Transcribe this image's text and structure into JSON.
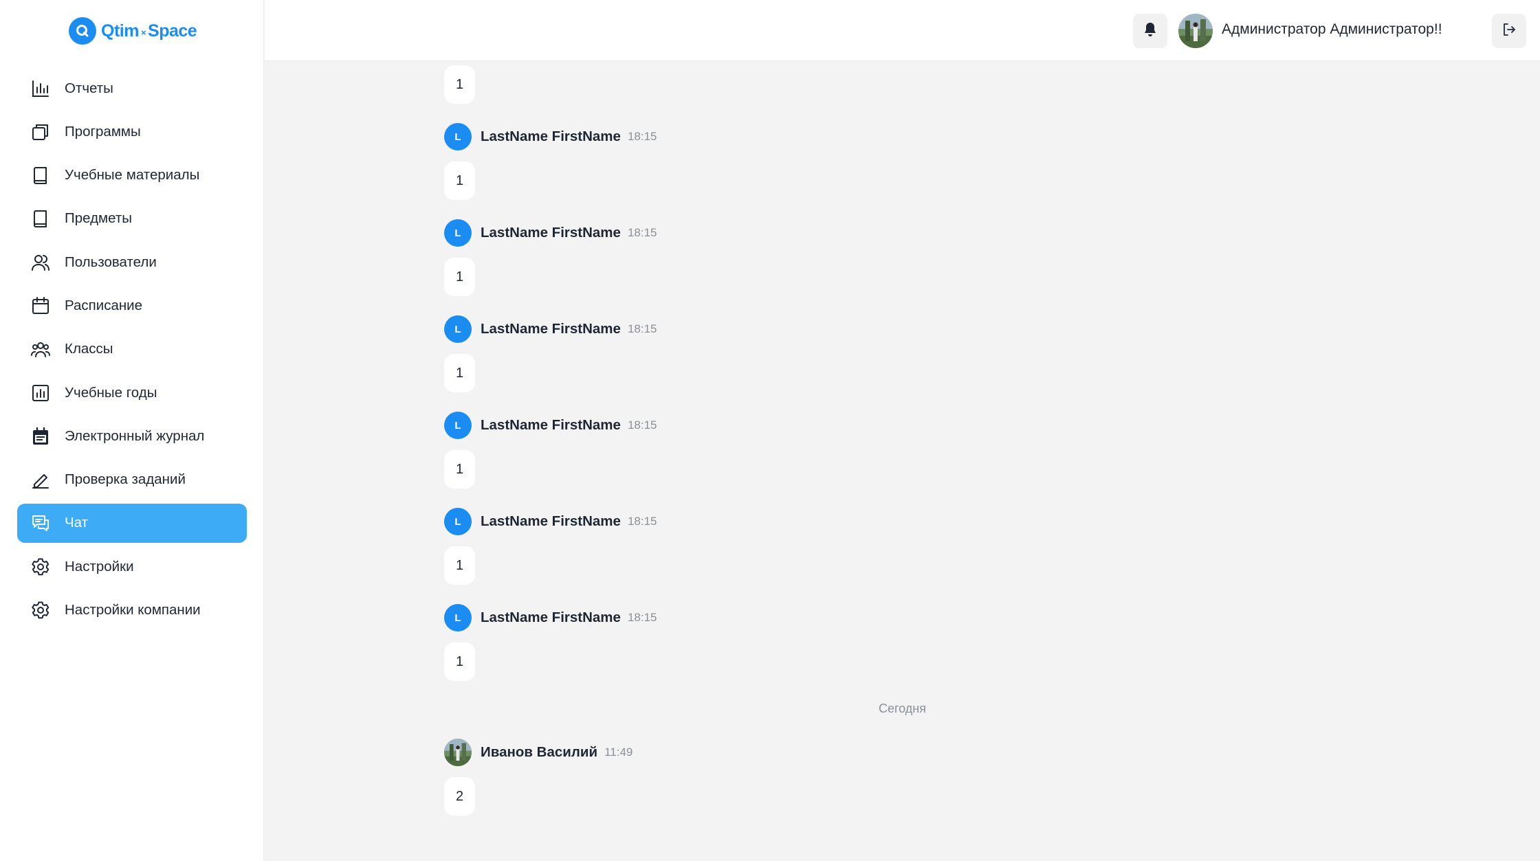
{
  "brand": {
    "name_left": "Qtim",
    "separator": "×",
    "name_right": "Space",
    "color": "#1b8cf2"
  },
  "sidebar": {
    "items": [
      {
        "label": "Отчеты",
        "icon": "bar-chart-icon"
      },
      {
        "label": "Программы",
        "icon": "copy-icon"
      },
      {
        "label": "Учебные материалы",
        "icon": "book-icon"
      },
      {
        "label": "Предметы",
        "icon": "book-icon"
      },
      {
        "label": "Пользователи",
        "icon": "users-icon"
      },
      {
        "label": "Расписание",
        "icon": "calendar-icon"
      },
      {
        "label": "Классы",
        "icon": "group-icon"
      },
      {
        "label": "Учебные годы",
        "icon": "chart-square-icon"
      },
      {
        "label": "Электронный журнал",
        "icon": "calendar-filled-icon"
      },
      {
        "label": "Проверка заданий",
        "icon": "pencil-icon"
      },
      {
        "label": "Чат",
        "icon": "chat-icon",
        "active": true
      },
      {
        "label": "Настройки",
        "icon": "gear-icon"
      },
      {
        "label": "Настройки компании",
        "icon": "gear-icon"
      }
    ],
    "active_color": "#3eabf6"
  },
  "header": {
    "user_name": "Администратор Администратор!!"
  },
  "chat": {
    "messages": [
      {
        "text": "1"
      },
      {
        "avatar_letter": "L",
        "author": "LastName FirstName",
        "time": "18:15",
        "text": "1"
      },
      {
        "avatar_letter": "L",
        "author": "LastName FirstName",
        "time": "18:15",
        "text": "1"
      },
      {
        "avatar_letter": "L",
        "author": "LastName FirstName",
        "time": "18:15",
        "text": "1"
      },
      {
        "avatar_letter": "L",
        "author": "LastName FirstName",
        "time": "18:15",
        "text": "1"
      },
      {
        "avatar_letter": "L",
        "author": "LastName FirstName",
        "time": "18:15",
        "text": "1"
      },
      {
        "avatar_letter": "L",
        "author": "LastName FirstName",
        "time": "18:15",
        "text": "1"
      }
    ],
    "date_separator": "Сегодня",
    "today_message": {
      "author": "Иванов Василий",
      "time": "11:49",
      "text": "2"
    }
  }
}
